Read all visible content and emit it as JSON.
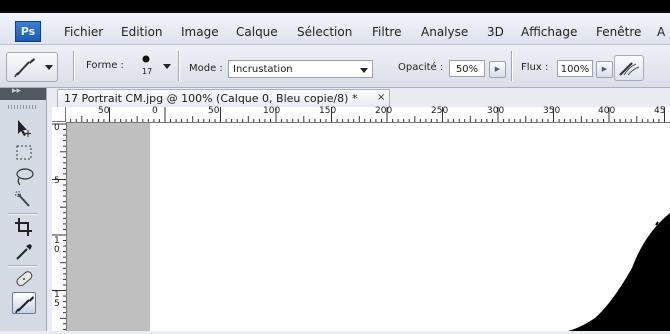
{
  "app": {
    "logo_text": "Ps"
  },
  "menu": [
    "Fichier",
    "Edition",
    "Image",
    "Calque",
    "Sélection",
    "Filtre",
    "Analyse",
    "3D",
    "Affichage",
    "Fenêtre",
    "A"
  ],
  "options": {
    "forme_label": "Forme :",
    "brush_size": "17",
    "mode_label": "Mode :",
    "mode_value": "Incrustation",
    "opacite_label": "Opacité :",
    "opacite_value": "50%",
    "flux_label": "Flux :",
    "flux_value": "100%"
  },
  "document": {
    "tab_title": "17 Portrait CM.jpg @ 100% (Calque 0, Bleu copie/8) *",
    "close_glyph": "×"
  },
  "ruler": {
    "h_labels": [
      "50",
      "0",
      "50",
      "100",
      "150",
      "200",
      "250",
      "300",
      "350",
      "400",
      "45"
    ],
    "v_labels": [
      "0",
      "5",
      "1",
      "0",
      "1",
      "5"
    ]
  },
  "toolbox": {
    "tools": [
      {
        "name": "move-tool-icon",
        "selected": false
      },
      {
        "name": "marquee-tool-icon",
        "selected": false
      },
      {
        "name": "lasso-tool-icon",
        "selected": false
      },
      {
        "name": "quick-selection-tool-icon",
        "selected": false
      },
      {
        "name": "crop-tool-icon",
        "selected": false
      },
      {
        "name": "eyedropper-tool-icon",
        "selected": false
      },
      {
        "name": "healing-brush-tool-icon",
        "selected": false
      },
      {
        "name": "brush-tool-icon",
        "selected": true
      }
    ]
  },
  "colors": {
    "menubar": "#e6eaf2",
    "accent": "#1b5bb3",
    "canvas_bg": "#bfbfbf"
  }
}
